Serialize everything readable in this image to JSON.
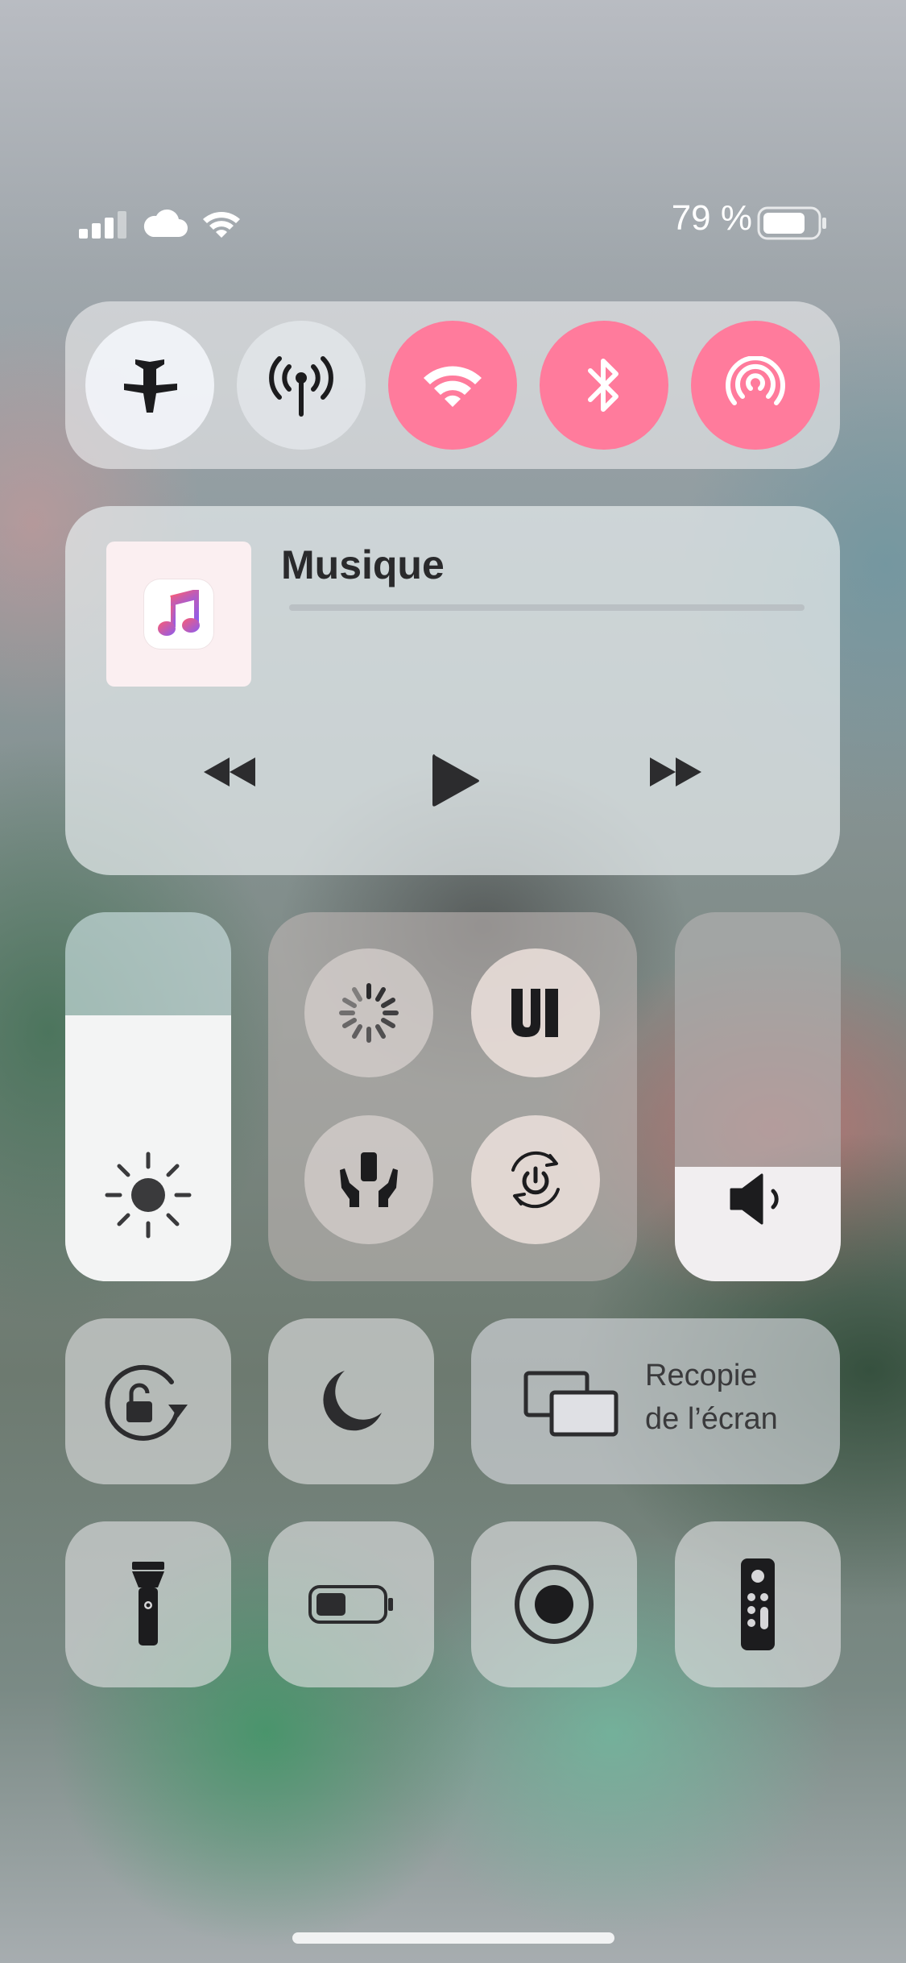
{
  "status_bar": {
    "battery_percent": "79 %",
    "battery_level": 0.79,
    "signal_bars": 3,
    "icons": [
      "cellular-signal-icon",
      "icloud-icon",
      "wifi-icon",
      "battery-icon"
    ]
  },
  "connectivity": {
    "toggles": [
      {
        "name": "airplane-mode",
        "icon": "airplane-icon",
        "on": false
      },
      {
        "name": "cellular-data",
        "icon": "antenna-icon",
        "on": false
      },
      {
        "name": "wifi",
        "icon": "wifi-icon",
        "on": true
      },
      {
        "name": "bluetooth",
        "icon": "bluetooth-icon",
        "on": true
      },
      {
        "name": "airdrop",
        "icon": "airdrop-icon",
        "on": true
      }
    ],
    "active_color": "#ff7b9c"
  },
  "music": {
    "title": "Musique",
    "icons": [
      "previous-track-icon",
      "play-icon",
      "next-track-icon"
    ]
  },
  "sliders": {
    "brightness_level": 0.72,
    "volume_level": 0.31
  },
  "accessibility_group": {
    "icons": [
      "loading-spinner-icon",
      "ui-icon",
      "hands-support-icon",
      "power-sync-icon"
    ]
  },
  "screen_mirroring": {
    "line1": "Recopie",
    "line2": "de l’écran"
  },
  "tiles": [
    "orientation-lock-icon",
    "moon-icon",
    "flashlight-icon",
    "low-power-battery-icon",
    "screen-record-icon",
    "tv-remote-icon"
  ]
}
